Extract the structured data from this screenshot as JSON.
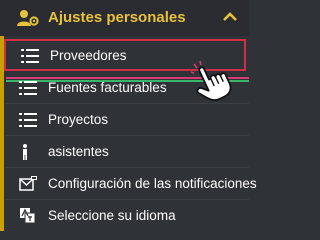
{
  "header": {
    "title": "Ajustes personales",
    "icon": "user-gear-icon",
    "chevron": "chevron-up-icon",
    "accent_color": "#e7c23a"
  },
  "menu": {
    "items": [
      {
        "label": "Proveedores",
        "icon": "list-icon",
        "selected": true
      },
      {
        "label": "Fuentes facturables",
        "icon": "list-icon"
      },
      {
        "label": "Proyectos",
        "icon": "list-icon"
      },
      {
        "label": "asistentes",
        "icon": "person-icon"
      },
      {
        "label": "Configuración de las notificaciones",
        "icon": "notification-settings-icon"
      },
      {
        "label": "Seleccione su idioma",
        "icon": "language-icon"
      }
    ]
  },
  "colors": {
    "background": "#2f3237",
    "highlight_border": "#cf2f44",
    "pink_line": "#d63b77",
    "green_line": "#3ab56b"
  },
  "cursor": {
    "icon": "hand-pointer-icon"
  }
}
